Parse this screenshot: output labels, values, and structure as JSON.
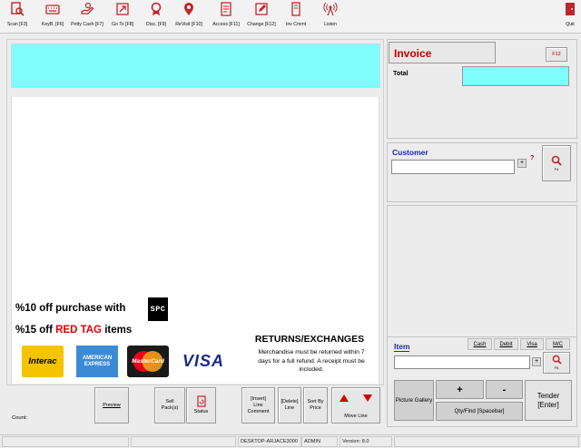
{
  "toolbar": {
    "scan": "Scan [F3]",
    "keyboard": "KeyB. [F6]",
    "petty_cash": "Petty Cash [F7]",
    "goto": "Go To [F8]",
    "discount": "Disc. [F9]",
    "revisit": "ReVisit [F10]",
    "access": "Access [F11]",
    "change": "Change [F12]",
    "inv_cmmt": "Inv Cmmt",
    "listen": "Listen",
    "quit": "Quit"
  },
  "promo": {
    "line1_text": "%10 off purchase with",
    "logo": "SPC",
    "line2_prefix": "%15 off",
    "line2_red": "RED TAG",
    "line2_suffix": "items"
  },
  "cards": {
    "interac": "Interac",
    "amex_top": "AMERICAN",
    "amex_bottom": "EXPRESS",
    "mastercard": "MasterCard",
    "visa": "VISA"
  },
  "returns": {
    "title": "RETURNS/EXCHANGES",
    "body": "Merchandise must be returned within 7 days for a full refund. A receipt must be included."
  },
  "bottom_buttons": {
    "count": "Count:",
    "preview": "Preview",
    "sell_packs_1": "Sell",
    "sell_packs_2": "Pack(s)",
    "status": "Status",
    "insert_1": "[Insert]",
    "insert_2": "Line",
    "insert_3": "Comment",
    "delete_1": "[Delete]",
    "delete_2": "Line",
    "sort_1": "Sort By",
    "sort_2": "Price",
    "move_line": "Move Line"
  },
  "invoice": {
    "title": "Invoice",
    "f12": "F12",
    "total_label": "Total"
  },
  "customer": {
    "label": "Customer",
    "plus": "+",
    "question": "?",
    "search_key": "F4"
  },
  "item": {
    "label": "Item",
    "cash": "Cash",
    "debit": "Debit",
    "visa": "Visa",
    "mc": "M/C",
    "plus": "+",
    "search_key": "F5"
  },
  "keypad": {
    "picture_gallery": "Picture Gallery",
    "plus": "+",
    "minus": "-",
    "qty_find": "Qty/Find [Spacebar]",
    "tender": "Tender",
    "tender_key": "[Enter]"
  },
  "statusbar": {
    "machine": "DESKTOP-ARJACE3000",
    "user": "ADMIN",
    "version": "Version: 8.0"
  },
  "colors": {
    "cyan": "#7ffcfc",
    "red": "#e00000",
    "blue_label": "#1a2aa8",
    "icon_red": "#c0252b"
  }
}
